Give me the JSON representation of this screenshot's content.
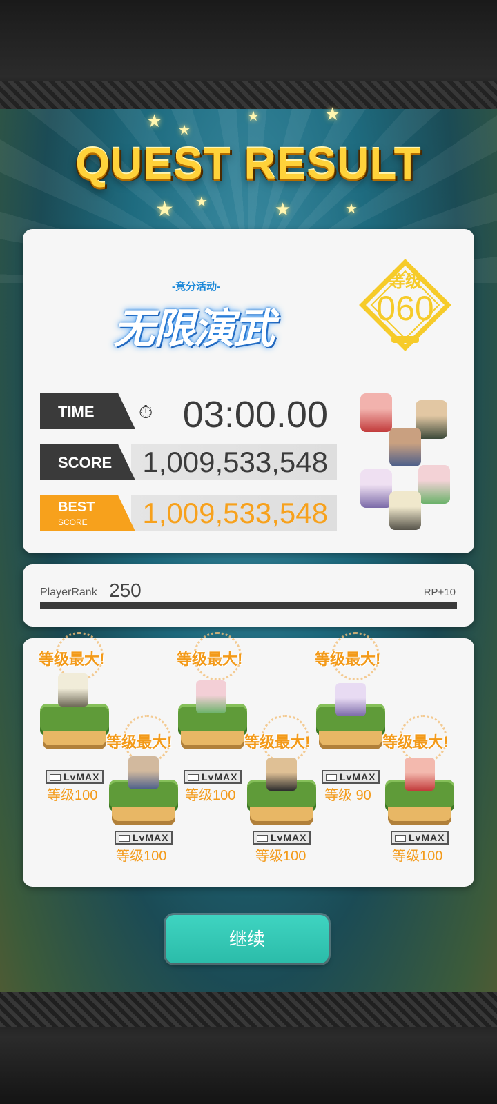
{
  "header": {
    "title": "QUEST RESULT"
  },
  "event": {
    "subtitle": "-竟分活动-",
    "name": "无限演武"
  },
  "rank": {
    "label": "等级",
    "value": "060"
  },
  "stats": [
    {
      "label": "TIME",
      "value": "03:00.00"
    },
    {
      "label": "SCORE",
      "value": "1,009,533,548"
    },
    {
      "label_top": "BEST",
      "label_bottom": "SCORE",
      "value": "1,009,533,548"
    }
  ],
  "player_rank": {
    "label": "PlayerRank",
    "value": "250",
    "rp": "RP+10"
  },
  "units": [
    {
      "max_text": "等级最大!",
      "lv_badge": "LvMAX",
      "level_text": "等级100",
      "colors": [
        "#e7e2d0",
        "#6f6a58"
      ]
    },
    {
      "max_text": "等级最大!",
      "lv_badge": "LvMAX",
      "level_text": "等级100",
      "colors": [
        "#c9b39a",
        "#4b5e8a"
      ]
    },
    {
      "max_text": "等级最大!",
      "lv_badge": "LvMAX",
      "level_text": "等级100",
      "colors": [
        "#f3c9d1",
        "#6bb26a"
      ]
    },
    {
      "max_text": "等级最大!",
      "lv_badge": "LvMAX",
      "level_text": "等级100",
      "colors": [
        "#d9b890",
        "#2d2d2d"
      ]
    },
    {
      "max_text": "等级最大!",
      "lv_badge": "LvMAX",
      "level_text": "等级 90",
      "colors": [
        "#e3d5f0",
        "#7b6aa8"
      ]
    },
    {
      "max_text": "等级最大!",
      "lv_badge": "LvMAX",
      "level_text": "等级100",
      "colors": [
        "#f1b3a8",
        "#c23b3b"
      ]
    }
  ],
  "continue_button": {
    "label": "继续"
  },
  "colors": {
    "accent_orange": "#f7a11c",
    "accent_teal": "#2bbca9",
    "gold": "#f6cb2a"
  }
}
